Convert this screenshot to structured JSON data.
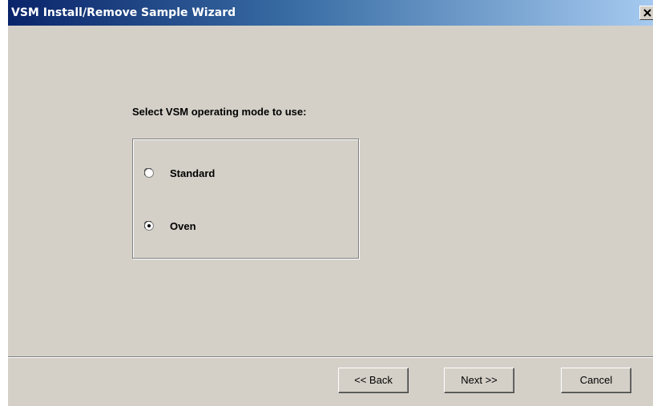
{
  "window": {
    "title": "VSM Install/Remove Sample Wizard",
    "close_icon": "close-icon",
    "titlebar_colors": [
      "#0a246a",
      "#a6caf0"
    ],
    "background": "#d4d0c8"
  },
  "wizard": {
    "prompt": "Select VSM operating mode to use:",
    "modes": [
      {
        "label": "Standard",
        "selected": false
      },
      {
        "label": "Oven",
        "selected": true
      }
    ]
  },
  "buttons": {
    "back": "<< Back",
    "next": "Next >>",
    "cancel": "Cancel"
  }
}
